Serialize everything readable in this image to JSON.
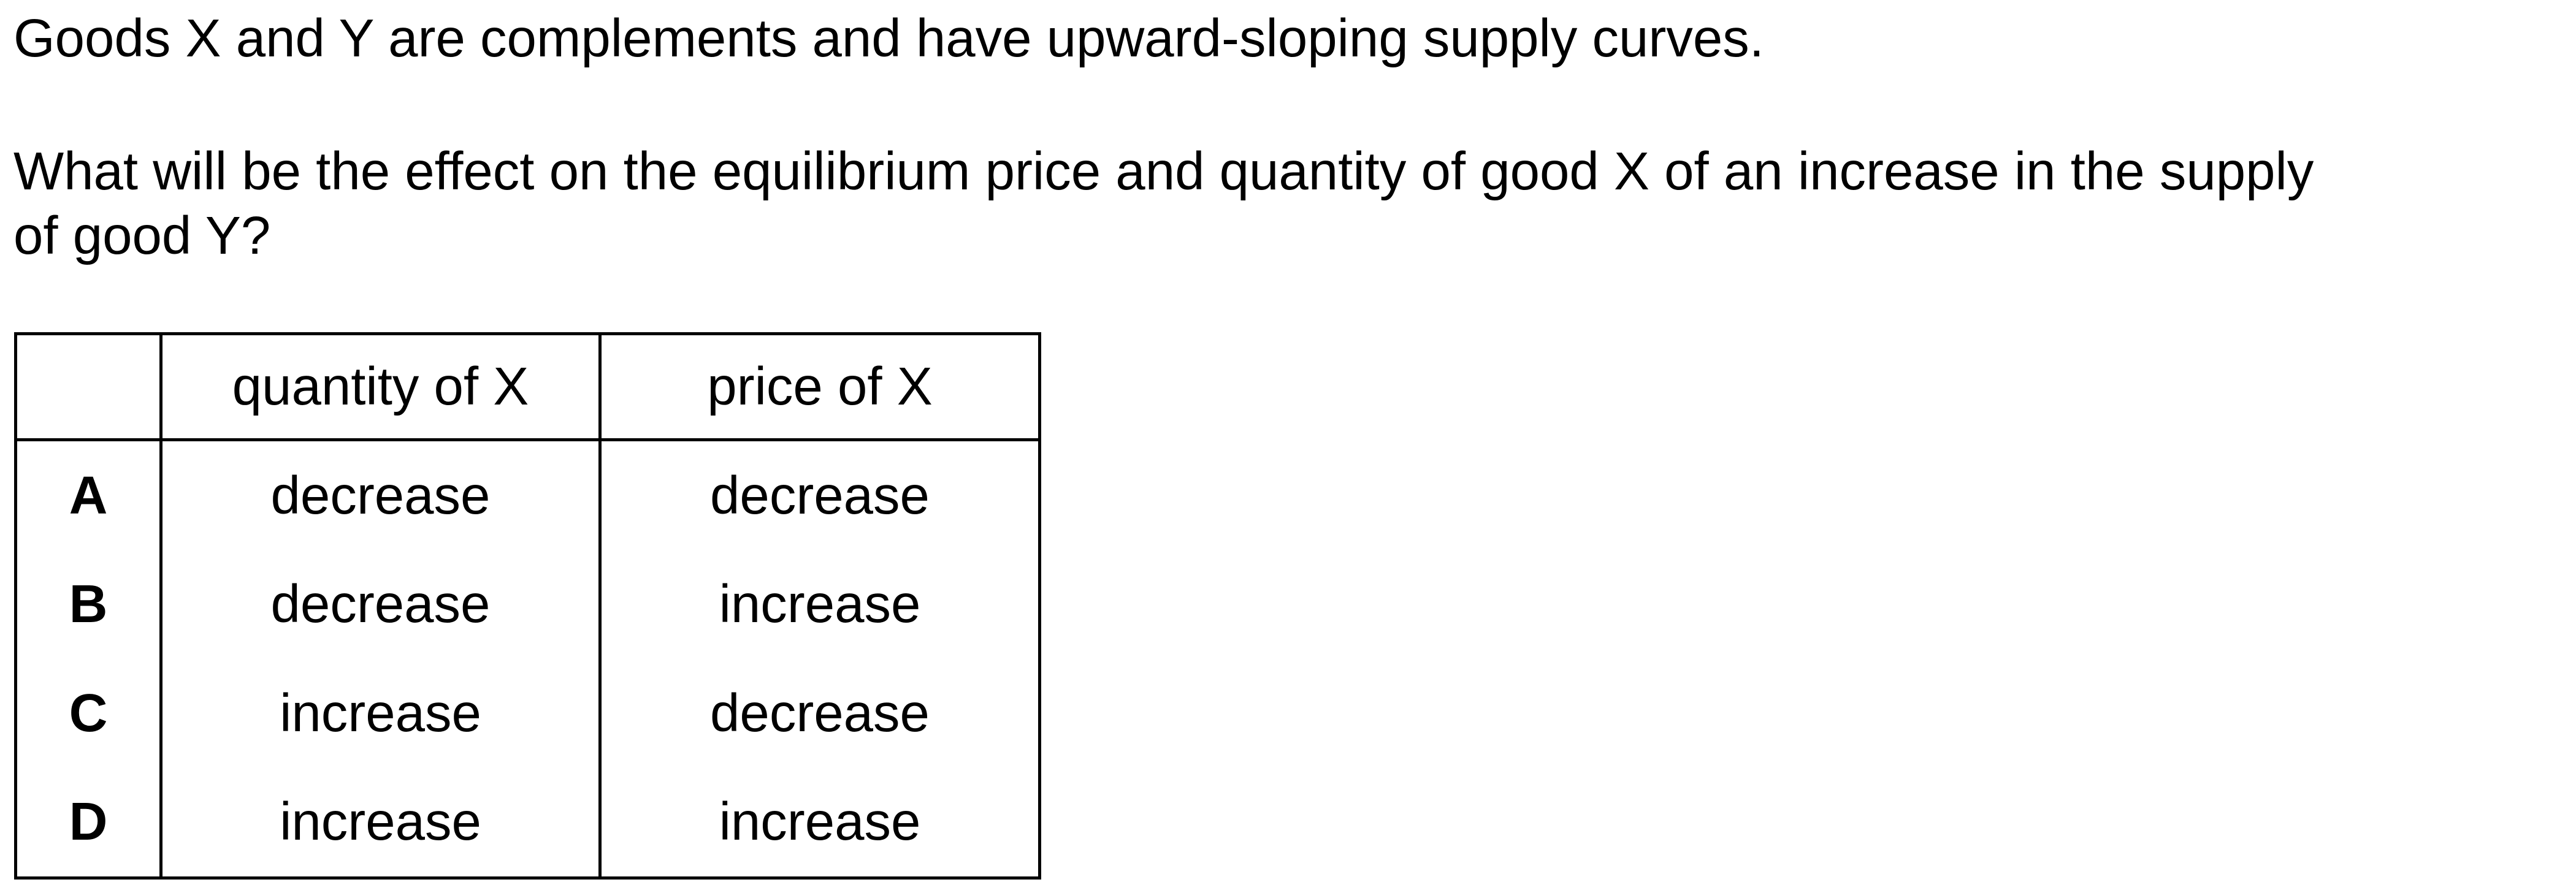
{
  "intro": "Goods X and Y are complements and have upward-sloping supply curves.",
  "question": {
    "line1": "What will be the effect on the equilibrium price and quantity of good X of an increase in the supply",
    "line2": "of good Y?"
  },
  "table": {
    "headers": [
      "",
      "quantity of X",
      "price of X"
    ],
    "rows": [
      {
        "letter": "A",
        "quantity": "decrease",
        "price": "decrease"
      },
      {
        "letter": "B",
        "quantity": "decrease",
        "price": "increase"
      },
      {
        "letter": "C",
        "quantity": "increase",
        "price": "decrease"
      },
      {
        "letter": "D",
        "quantity": "increase",
        "price": "increase"
      }
    ]
  }
}
